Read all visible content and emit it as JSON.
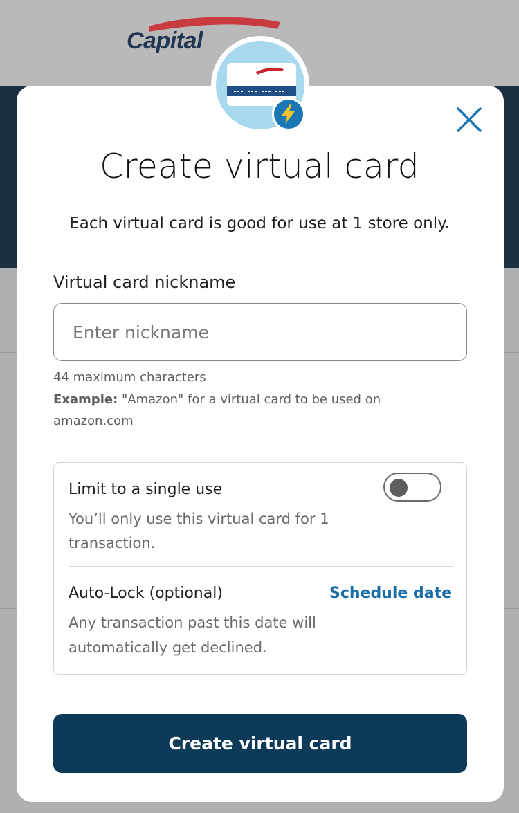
{
  "background": {
    "logo_text": "Capital"
  },
  "modal": {
    "title": "Create virtual card",
    "subtitle": "Each virtual card is good for use at 1 store only.",
    "nickname": {
      "label": "Virtual card nickname",
      "placeholder": "Enter nickname",
      "value": "",
      "max_chars_hint": "44 maximum characters",
      "example_prefix": "Example:",
      "example_line1": " \"Amazon\" for a virtual card to be used on",
      "example_line2": "amazon.com"
    },
    "single_use": {
      "title": "Limit to a single use",
      "desc_line1": "You’ll only use this virtual card for 1",
      "desc_line2": "transaction.",
      "enabled": false
    },
    "auto_lock": {
      "title": "Auto-Lock (optional)",
      "link": "Schedule date",
      "desc_line1": "Any transaction past this date will",
      "desc_line2": "automatically get declined."
    },
    "submit_label": "Create virtual card"
  },
  "icons": {
    "close": "close-icon",
    "badge": "virtual-card-icon",
    "bolt": "lightning-bolt-icon"
  },
  "colors": {
    "primary_button": "#0e3a5a",
    "link": "#1a6fa8",
    "close_icon": "#1a77b4",
    "badge_bg": "#a9d9ee",
    "brand_red": "#c9252c",
    "brand_navy": "#213651"
  }
}
